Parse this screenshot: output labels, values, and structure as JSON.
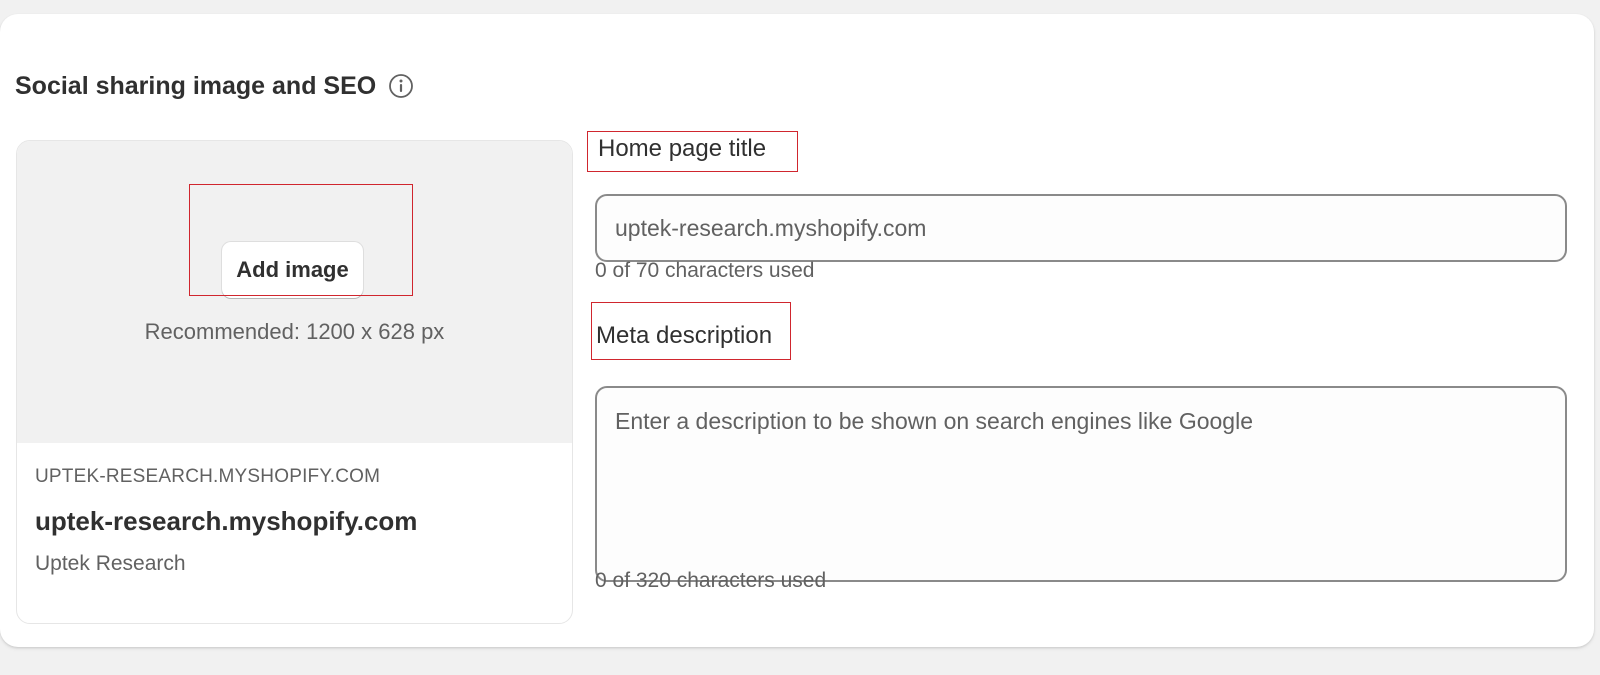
{
  "section": {
    "title": "Social sharing image and SEO",
    "info_icon": "info-icon"
  },
  "preview": {
    "add_image_label": "Add image",
    "recommended": "Recommended: 1200 x 628 px",
    "url": "UPTEK-RESEARCH.MYSHOPIFY.COM",
    "title": "uptek-research.myshopify.com",
    "store_name": "Uptek Research"
  },
  "fields": {
    "home_page_title": {
      "label": "Home page title",
      "placeholder": "uptek-research.myshopify.com",
      "value": "",
      "help": "0 of 70 characters used"
    },
    "meta_description": {
      "label": "Meta description",
      "placeholder": "Enter a description to be shown on search engines like Google",
      "value": "",
      "help": "0 of 320 characters used"
    }
  },
  "colors": {
    "highlight": "#d0262e",
    "background": "#f1f1f1",
    "text": "#303030",
    "subdued": "#616161"
  }
}
